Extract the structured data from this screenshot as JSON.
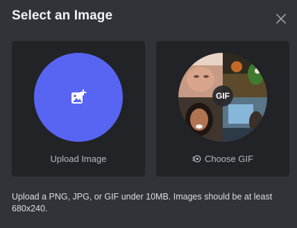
{
  "dialog": {
    "title": "Select an Image",
    "close_icon": "close-icon"
  },
  "options": {
    "upload": {
      "label": "Upload Image",
      "icon": "image-add-icon",
      "accent": "#5865f2"
    },
    "gif": {
      "label": "Choose GIF",
      "badge": "GIF",
      "icon": "gif-picker-icon"
    }
  },
  "hint": "Upload a PNG, JPG, or GIF under 10MB. Images should be at least 680x240."
}
